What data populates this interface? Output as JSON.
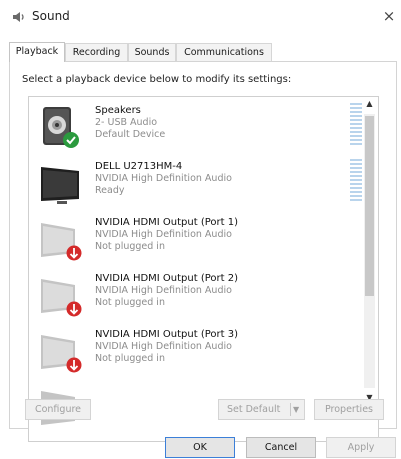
{
  "window": {
    "title": "Sound",
    "close_glyph": "×"
  },
  "tabs": [
    {
      "label": "Playback",
      "active": true
    },
    {
      "label": "Recording",
      "active": false
    },
    {
      "label": "Sounds",
      "active": false
    },
    {
      "label": "Communications",
      "active": false
    }
  ],
  "instruction": "Select a playback device below to modify its settings:",
  "devices": [
    {
      "name": "Speakers",
      "line1": "2- USB Audio",
      "line2": "Default Device",
      "icon": "speaker-icon",
      "badge": "default-check-icon",
      "meter": true
    },
    {
      "name": "DELL U2713HM-4",
      "line1": "NVIDIA High Definition Audio",
      "line2": "Ready",
      "icon": "monitor-icon",
      "badge": "",
      "meter": true
    },
    {
      "name": "NVIDIA HDMI Output (Port 1)",
      "line1": "NVIDIA High Definition Audio",
      "line2": "Not plugged in",
      "icon": "monitor-disconnected-icon",
      "badge": "unplugged-arrow-icon",
      "meter": false
    },
    {
      "name": "NVIDIA HDMI Output (Port 2)",
      "line1": "NVIDIA High Definition Audio",
      "line2": "Not plugged in",
      "icon": "monitor-disconnected-icon",
      "badge": "unplugged-arrow-icon",
      "meter": false
    },
    {
      "name": "NVIDIA HDMI Output (Port 3)",
      "line1": "NVIDIA High Definition Audio",
      "line2": "Not plugged in",
      "icon": "monitor-disconnected-icon",
      "badge": "unplugged-arrow-icon",
      "meter": false
    }
  ],
  "buttons": {
    "configure": "Configure",
    "set_default": "Set Default",
    "properties": "Properties",
    "ok": "OK",
    "cancel": "Cancel",
    "apply": "Apply"
  },
  "colors": {
    "meter": "#b9d4ec",
    "check_badge": "#2b9a3e",
    "unplug_badge": "#d42a2a",
    "ok_border": "#3c7fd8"
  }
}
